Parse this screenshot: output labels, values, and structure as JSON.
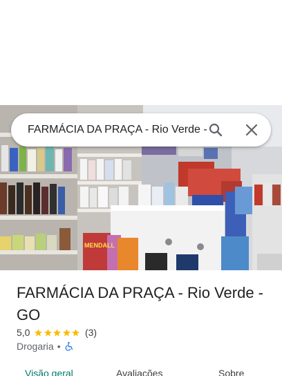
{
  "search": {
    "query": "FARMÁCIA DA PRAÇA - Rio Verde - G"
  },
  "place": {
    "name": "FARMÁCIA DA PRAÇA - Rio Verde - GO",
    "rating": "5,0",
    "stars": 5,
    "review_count": "(3)",
    "category": "Drogaria",
    "separator": "•",
    "accessibility_icon": "wheelchair-icon"
  },
  "tabs": [
    {
      "label": "Visão geral",
      "active": true
    },
    {
      "label": "Avaliações",
      "active": false
    },
    {
      "label": "Sobre",
      "active": false
    }
  ],
  "hero_image": {
    "sign_text": "MENDALL"
  },
  "colors": {
    "accent": "#00796b",
    "star": "#fbbc04",
    "wheelchair": "#1a73e8"
  }
}
